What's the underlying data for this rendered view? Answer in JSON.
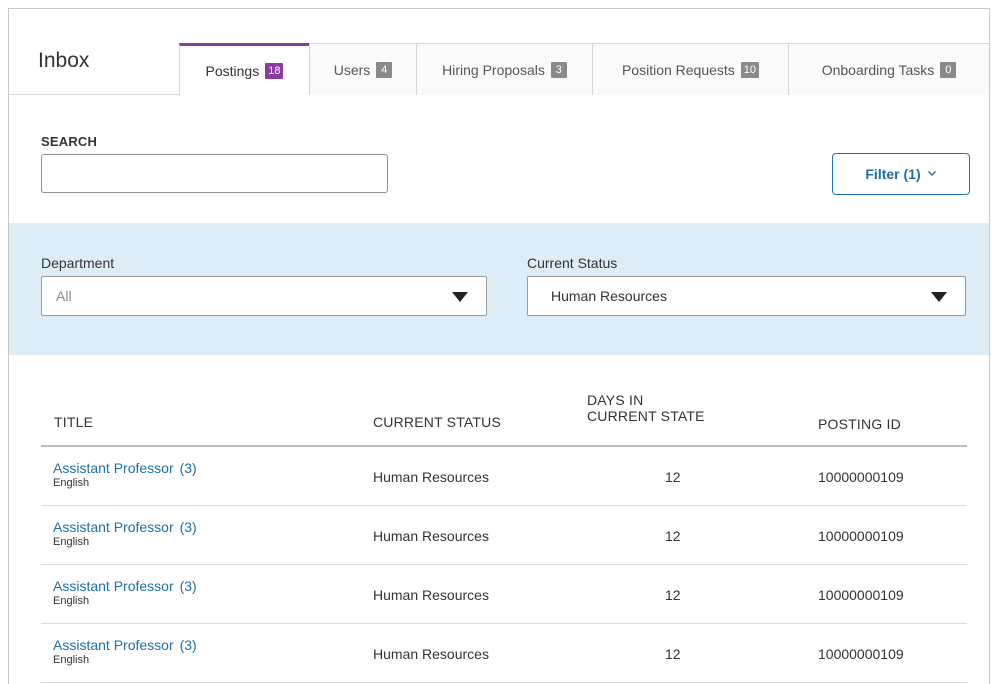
{
  "header": {
    "title": "Inbox",
    "tabs": [
      {
        "label": "Postings",
        "badge": "18"
      },
      {
        "label": "Users",
        "badge": "4"
      },
      {
        "label": "Hiring Proposals",
        "badge": "3"
      },
      {
        "label": "Position Requests",
        "badge": "10"
      },
      {
        "label": "Onboarding Tasks",
        "badge": "0"
      }
    ]
  },
  "search": {
    "label": "SEARCH",
    "value": ""
  },
  "filter_button": {
    "label": "Filter (1)"
  },
  "filters": {
    "department": {
      "label": "Department",
      "value": "All"
    },
    "current_status": {
      "label": "Current Status",
      "value": "Human Resources"
    }
  },
  "table": {
    "columns": {
      "title": "TITLE",
      "current_status": "CURRENT STATUS",
      "days_line1": "DAYS IN",
      "days_line2": "CURRENT STATE",
      "posting_id": "POSTING ID"
    },
    "rows": [
      {
        "title": "Assistant Professor",
        "count": "(3)",
        "dept": "English",
        "status": "Human Resources",
        "days": "12",
        "id": "10000000109"
      },
      {
        "title": "Assistant Professor",
        "count": "(3)",
        "dept": "English",
        "status": "Human Resources",
        "days": "12",
        "id": "10000000109"
      },
      {
        "title": "Assistant Professor",
        "count": "(3)",
        "dept": "English",
        "status": "Human Resources",
        "days": "12",
        "id": "10000000109"
      },
      {
        "title": "Assistant Professor",
        "count": "(3)",
        "dept": "English",
        "status": "Human Resources",
        "days": "12",
        "id": "10000000109"
      }
    ]
  },
  "colors": {
    "accent_purple": "#8b3d9e",
    "link_blue": "#1e6fae",
    "panel_bg": "#deedf5"
  }
}
